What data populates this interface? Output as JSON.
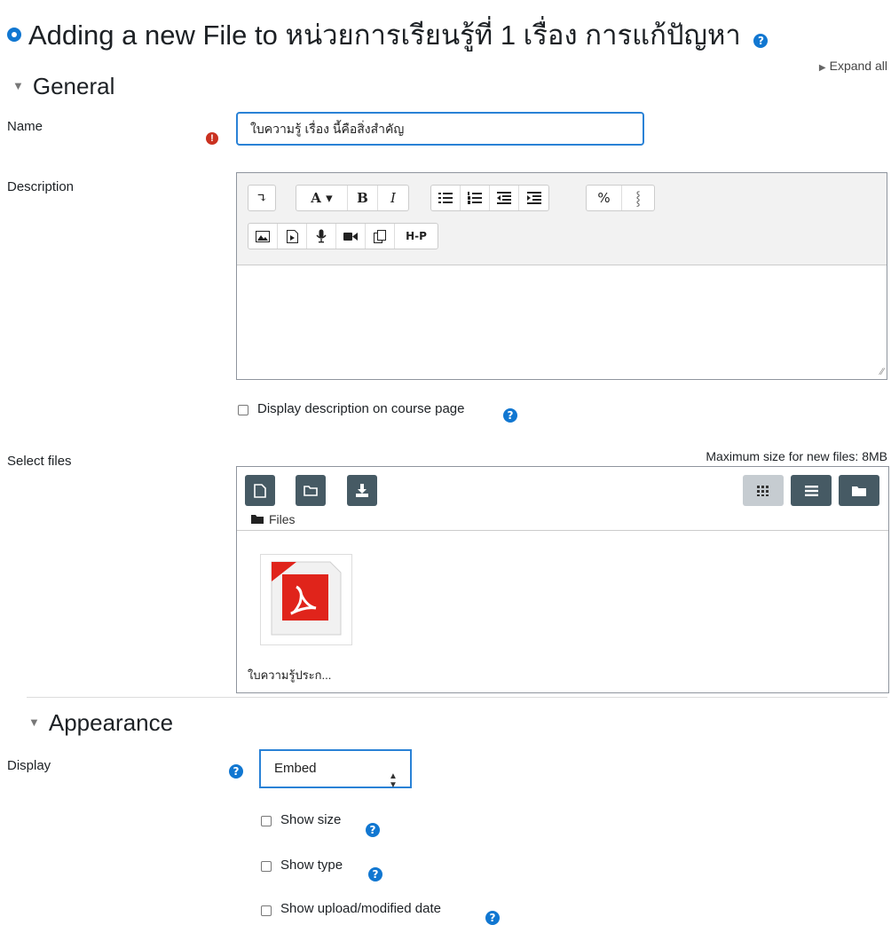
{
  "page": {
    "title": "Adding a new File to หน่วยการเรียนรู้ที่ 1 เรื่อง การแก้ปัญหา",
    "expand_all": "Expand all"
  },
  "general": {
    "heading": "General",
    "name_label": "Name",
    "name_value": "ใบความรู้ เรื่อง นี้คือสิ่งสำคัญ",
    "description_label": "Description",
    "display_description_label": "Display description on course page",
    "select_files_label": "Select files",
    "max_size": "Maximum size for new files: 8MB",
    "files_path": "Files",
    "file_name": "ใบความรู้ประก..."
  },
  "editor_toolbar": {
    "row1": [
      {
        "group": "collapse",
        "buttons": [
          "↴"
        ]
      },
      {
        "group": "style",
        "buttons": [
          "A▾",
          "B",
          "I"
        ]
      },
      {
        "group": "lists",
        "buttons": [
          "unordered-list",
          "ordered-list",
          "outdent",
          "indent"
        ]
      },
      {
        "group": "links",
        "buttons": [
          "link",
          "unlink"
        ]
      }
    ],
    "row2": [
      {
        "group": "media",
        "buttons": [
          "image",
          "media",
          "record-audio",
          "record-video",
          "manage-files",
          "H-P"
        ]
      }
    ]
  },
  "appearance": {
    "heading": "Appearance",
    "display_label": "Display",
    "display_value": "Embed",
    "show_size": "Show size",
    "show_type": "Show type",
    "show_date": "Show upload/modified date"
  },
  "colors": {
    "accent": "#1177d1",
    "focus_border": "#2a82d6",
    "required": "#ca3120",
    "filepicker_button": "#465a64",
    "pdf_red": "#e0241b"
  }
}
